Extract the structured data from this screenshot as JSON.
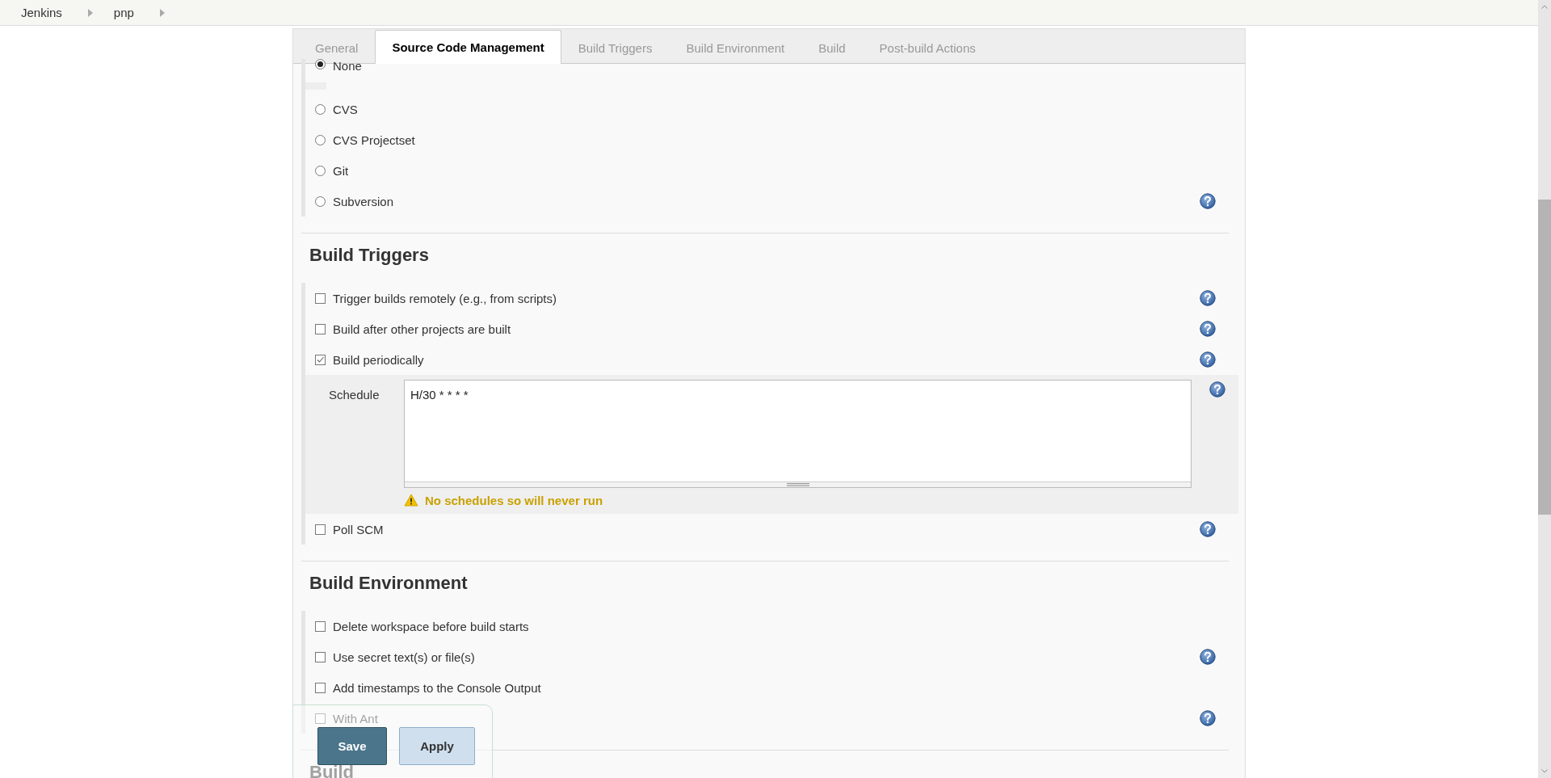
{
  "breadcrumbs": [
    {
      "label": "Jenkins"
    },
    {
      "label": "pnp"
    }
  ],
  "tabs": [
    {
      "label": "General",
      "selected": false
    },
    {
      "label": "Source Code Management",
      "selected": true
    },
    {
      "label": "Build Triggers",
      "selected": false
    },
    {
      "label": "Build Environment",
      "selected": false
    },
    {
      "label": "Build",
      "selected": false
    },
    {
      "label": "Post-build Actions",
      "selected": false
    }
  ],
  "scm": {
    "options": [
      {
        "label": "None",
        "selected": true,
        "help": false
      },
      {
        "label": "CVS",
        "selected": false,
        "help": false
      },
      {
        "label": "CVS Projectset",
        "selected": false,
        "help": false
      },
      {
        "label": "Git",
        "selected": false,
        "help": false
      },
      {
        "label": "Subversion",
        "selected": false,
        "help": true
      }
    ]
  },
  "sections": [
    {
      "title": "Build Triggers",
      "items": [
        {
          "label": "Trigger builds remotely (e.g., from scripts)",
          "checked": false,
          "help": true
        },
        {
          "label": "Build after other projects are built",
          "checked": false,
          "help": true
        },
        {
          "label": "Build periodically",
          "checked": true,
          "help": true,
          "schedule": {
            "label": "Schedule",
            "value": "H/30 * * * *",
            "help": true,
            "warning": "No schedules so will never run"
          }
        },
        {
          "label": "Poll SCM",
          "checked": false,
          "help": true
        }
      ]
    },
    {
      "title": "Build Environment",
      "items": [
        {
          "label": "Delete workspace before build starts",
          "checked": false,
          "help": false
        },
        {
          "label": "Use secret text(s) or file(s)",
          "checked": false,
          "help": true
        },
        {
          "label": "Add timestamps to the Console Output",
          "checked": false,
          "help": false
        },
        {
          "label": "With Ant",
          "checked": false,
          "help": true
        }
      ]
    },
    {
      "title": "Build"
    }
  ],
  "buttons": [
    {
      "label": "Save",
      "kind": "primary"
    },
    {
      "label": "Apply",
      "kind": "secondary"
    }
  ]
}
